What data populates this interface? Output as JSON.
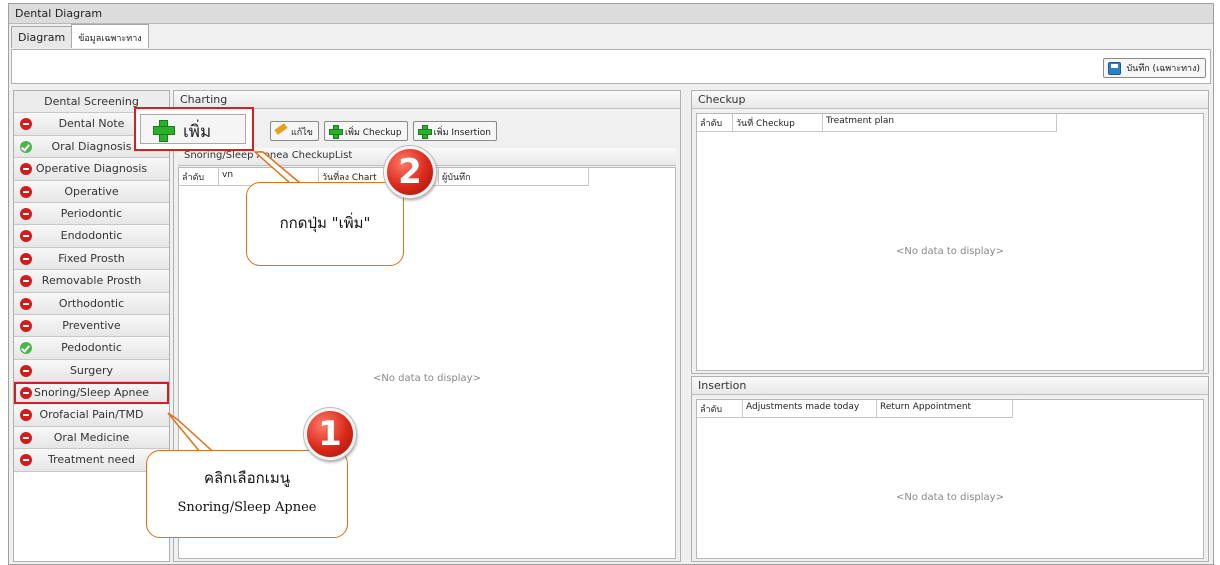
{
  "window": {
    "title": "Dental Diagram"
  },
  "tabs": [
    {
      "label": "Diagram"
    },
    {
      "label": "ข้อมูลเฉพาะทาง"
    }
  ],
  "toolbar": {
    "save_label": "บันทึก (เฉพาะทาง)"
  },
  "sidebar": {
    "items": [
      {
        "label": "Dental Screening",
        "status": "none"
      },
      {
        "label": "Dental Note",
        "status": "red"
      },
      {
        "label": "Oral Diagnosis",
        "status": "green"
      },
      {
        "label": "Operative Diagnosis",
        "status": "red"
      },
      {
        "label": "Operative",
        "status": "red"
      },
      {
        "label": "Periodontic",
        "status": "red"
      },
      {
        "label": "Endodontic",
        "status": "red"
      },
      {
        "label": "Fixed Prosth",
        "status": "red"
      },
      {
        "label": "Removable Prosth",
        "status": "red"
      },
      {
        "label": "Orthodontic",
        "status": "red"
      },
      {
        "label": "Preventive",
        "status": "red"
      },
      {
        "label": "Pedodontic",
        "status": "green"
      },
      {
        "label": "Surgery",
        "status": "red"
      },
      {
        "label": "Snoring/Sleep Apnee",
        "status": "red"
      },
      {
        "label": "Orofacial Pain/TMD",
        "status": "red"
      },
      {
        "label": "Oral Medicine",
        "status": "red"
      },
      {
        "label": "Treatment need",
        "status": "red"
      }
    ]
  },
  "charting": {
    "title": "Charting",
    "add_label": "เพิ่ม",
    "edit_label": "แก้ไข",
    "add_checkup_label": "เพิ่ม Checkup",
    "add_insertion_label": "เพิ่ม Insertion",
    "list_title": "Snoring/Sleep Apnea CheckupList",
    "columns": [
      "ลำดับ",
      "vn",
      "วันที่ลง Chart",
      "ผู้บันทึก"
    ],
    "no_data": "<No data to display>"
  },
  "checkup": {
    "title": "Checkup",
    "columns": [
      "ลำดับ",
      "วันที่ Checkup",
      "Treatment plan"
    ],
    "no_data": "<No data to display>"
  },
  "insertion": {
    "title": "Insertion",
    "columns": [
      "ลำดับ",
      "Adjustments made today",
      "Return Appointment"
    ],
    "no_data": "<No data to display>"
  },
  "annotations": {
    "step1_number": "1",
    "step1_line1": "คลิกเลือกเมนู",
    "step1_line2": "Snoring/Sleep Apnee",
    "step2_number": "2",
    "step2_text": "กกดปุ่ม \"เพิ่ม\""
  },
  "colors": {
    "highlight": "#d32020",
    "callout_border": "#e0701a",
    "badge": "#d8281a"
  }
}
